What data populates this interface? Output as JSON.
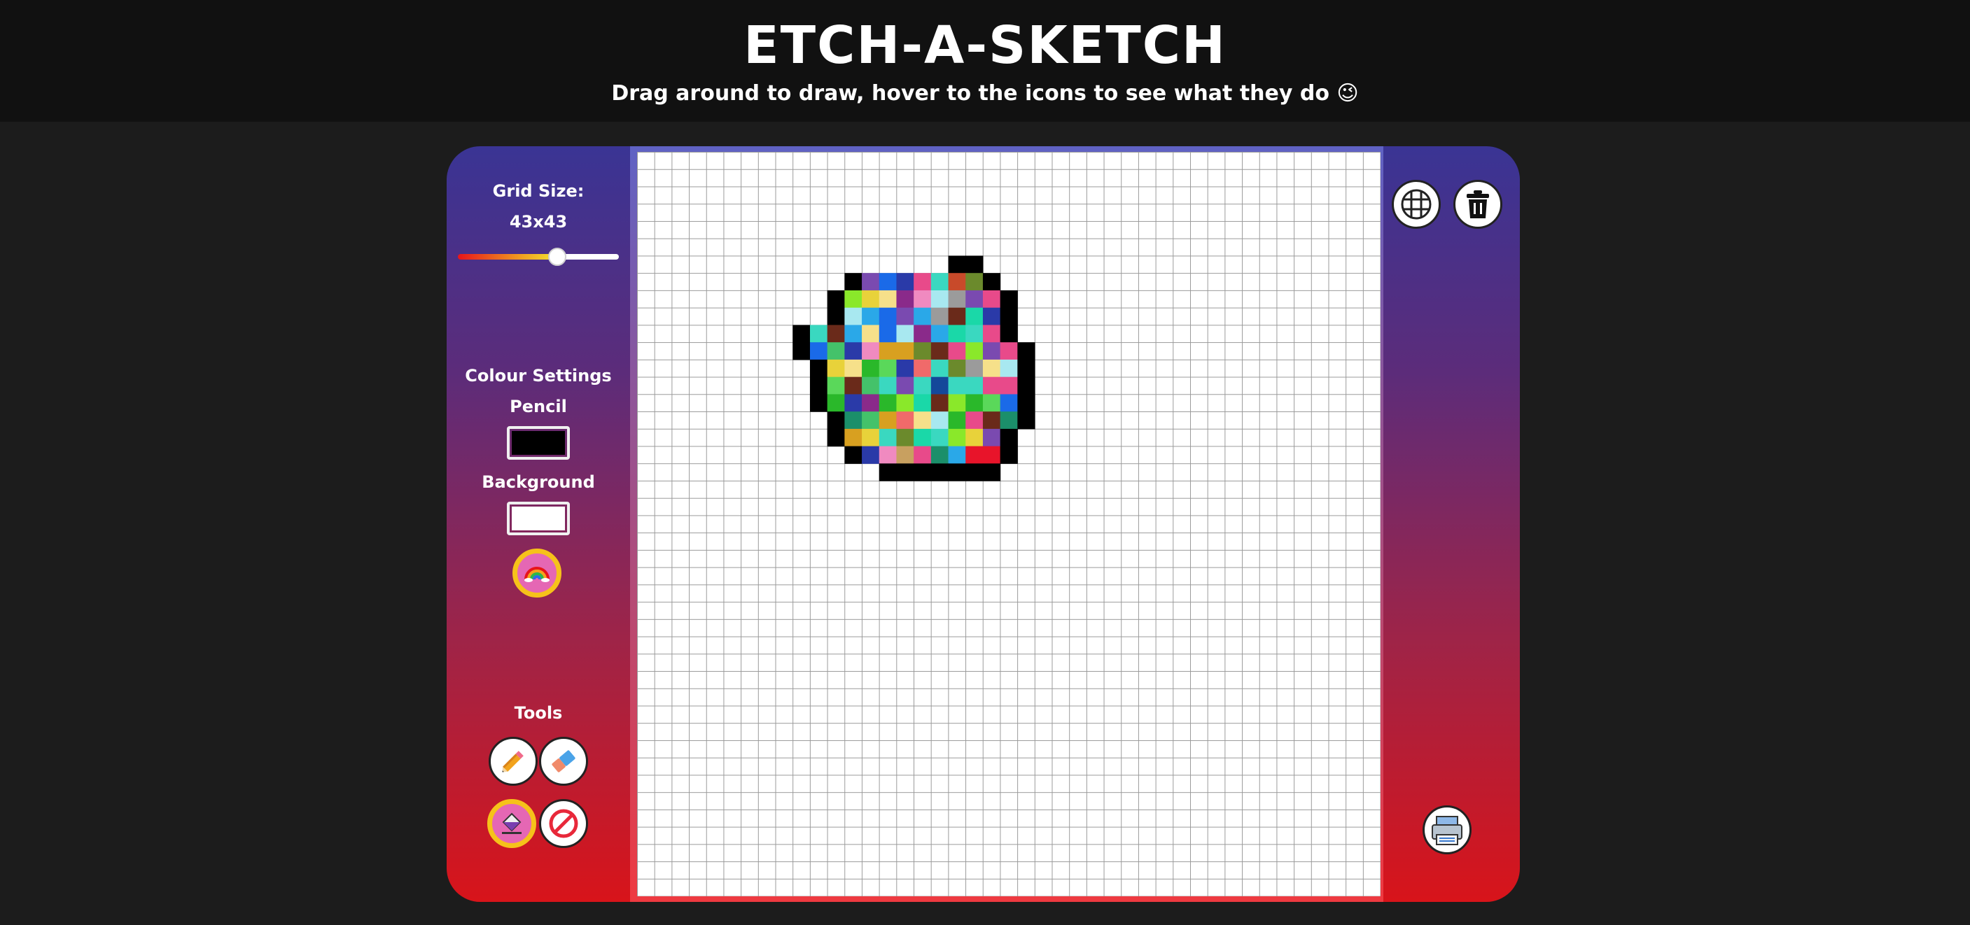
{
  "header": {
    "title": "ETCH-A-SKETCH",
    "subtitle": "Drag around to draw, hover to the icons to see what they do 😉"
  },
  "grid_settings": {
    "label": "Grid Size:",
    "value_text": "43x43",
    "size": 43,
    "slider_fraction": 0.63
  },
  "colour_settings": {
    "label": "Colour Settings",
    "pencil_label": "Pencil",
    "pencil_color": "#000000",
    "background_label": "Background",
    "background_color": "#ffffff",
    "rainbow_icon": "rainbow-icon",
    "rainbow_active": true
  },
  "tools": {
    "label": "Tools",
    "items": [
      {
        "name": "pencil",
        "icon": "pencil-icon",
        "active": false
      },
      {
        "name": "eraser",
        "icon": "eraser-icon",
        "active": false
      },
      {
        "name": "fill",
        "icon": "fill-bucket-icon",
        "active": true
      },
      {
        "name": "disable",
        "icon": "no-entry-icon",
        "active": false
      }
    ]
  },
  "right_tools": {
    "grid_toggle_icon": "grid-icon",
    "clear_icon": "trash-icon",
    "save_icon": "save-icon"
  },
  "colors": {
    "panel_top": "#3a3494",
    "panel_bottom": "#d8141a",
    "active_ring": "#f6c21a",
    "active_fill": "#e567b4"
  }
}
